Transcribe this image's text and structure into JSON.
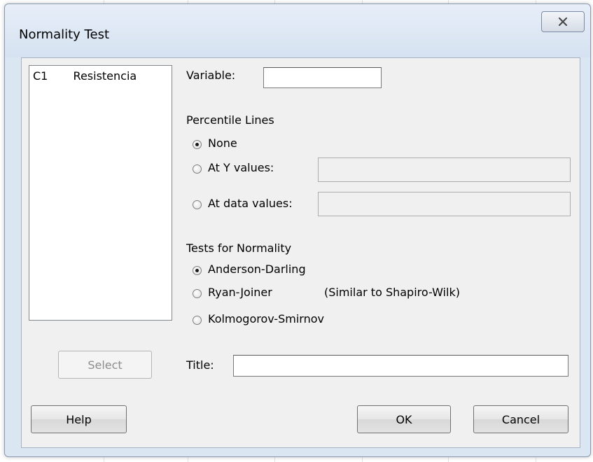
{
  "dialog": {
    "title": "Normality Test",
    "close_icon": "close-icon"
  },
  "variables_list": {
    "items": [
      {
        "column": "C1",
        "name": "Resistencia"
      }
    ]
  },
  "variable": {
    "label": "Variable:",
    "value": ""
  },
  "percentile_lines": {
    "heading": "Percentile Lines",
    "options": [
      {
        "label": "None",
        "selected": true
      },
      {
        "label": "At Y values:",
        "selected": false,
        "value": ""
      },
      {
        "label": "At data values:",
        "selected": false,
        "value": ""
      }
    ]
  },
  "tests": {
    "heading": "Tests for Normality",
    "options": [
      {
        "label": "Anderson-Darling",
        "selected": true
      },
      {
        "label": "Ryan-Joiner",
        "note": "(Similar to Shapiro-Wilk)",
        "selected": false
      },
      {
        "label": "Kolmogorov-Smirnov",
        "selected": false
      }
    ]
  },
  "title_field": {
    "label": "Title:",
    "value": ""
  },
  "buttons": {
    "select": "Select",
    "help": "Help",
    "ok": "OK",
    "cancel": "Cancel"
  }
}
